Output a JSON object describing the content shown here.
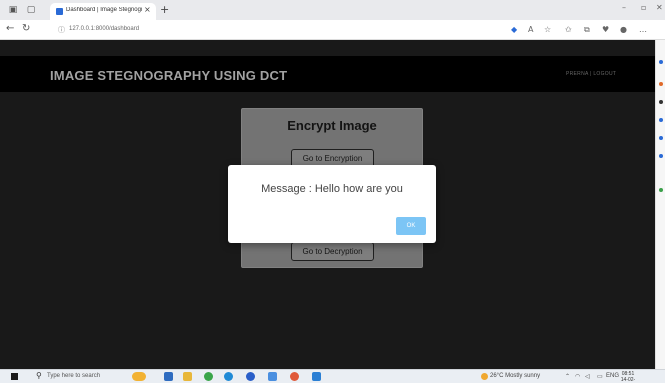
{
  "browser": {
    "tab_title": "Dashboard | Image Stegnograph",
    "tab_close": "×",
    "new_tab": "+",
    "url": "127.0.0.1:8000/dashboard",
    "minimize": "–",
    "maximize": "▫",
    "close": "✕"
  },
  "header": {
    "title": "IMAGE STEGNOGRAPHY USING DCT",
    "user_link": "PRERNA | LOGOUT"
  },
  "card": {
    "title": "Encrypt Image",
    "encrypt_button": "Go to Encryption",
    "decrypt_button": "Go to Decryption"
  },
  "modal": {
    "message": "Message : Hello how are you",
    "ok_label": "OK"
  },
  "taskbar": {
    "search_placeholder": "Type here to search",
    "weather": "26°C  Mostly sunny",
    "lang": "ENG",
    "time": "08:51",
    "date": "14-02-2023"
  },
  "colors": {
    "page_bg": "#222222",
    "header_bg": "#000000",
    "card_bg": "#9a9a9a",
    "ok_button": "#7cc5f5"
  }
}
